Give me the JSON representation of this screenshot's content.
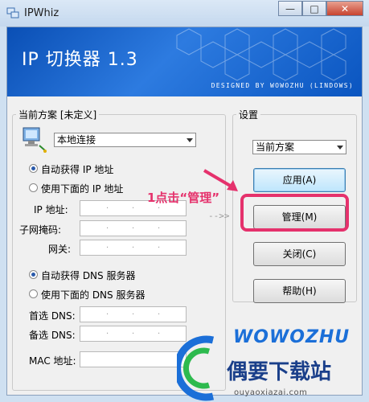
{
  "window": {
    "title": "IPWhiz",
    "minimize": "—",
    "maximize": "□",
    "close": "✕"
  },
  "banner": {
    "title": "IP 切换器 1.3",
    "subtitle": "DESIGNED BY WOWOZHU (LINDOWS)"
  },
  "scheme_group": {
    "legend": "当前方案 [未定义]",
    "adapter_select": "本地连接",
    "ip_auto": "自动获得 IP 地址",
    "ip_manual": "使用下面的 IP 地址",
    "ip_address_label": "IP 地址:",
    "subnet_label": "子网掩码:",
    "gateway_label": "网关:",
    "dns_auto": "自动获得 DNS 服务器",
    "dns_manual": "使用下面的 DNS 服务器",
    "dns_primary_label": "首选 DNS:",
    "dns_secondary_label": "备选 DNS:",
    "mac_label": "MAC 地址:"
  },
  "settings_group": {
    "legend": "设置",
    "scheme_select": "当前方案",
    "apply_button": "应用(A)",
    "manage_button": "管理(M)",
    "close_button": "关闭(C)",
    "help_button": "帮助(H)"
  },
  "annotation": {
    "callout": "1点击“管理”",
    "dashed_arrow": "-->>",
    "accent_color": "#e5316c"
  },
  "watermark": {
    "brand": "WOWOZHU",
    "site_name": "偶要下载站",
    "url": "ouyaoxiazai.com"
  },
  "icons": [
    "app-icon",
    "network-computer-icon"
  ]
}
